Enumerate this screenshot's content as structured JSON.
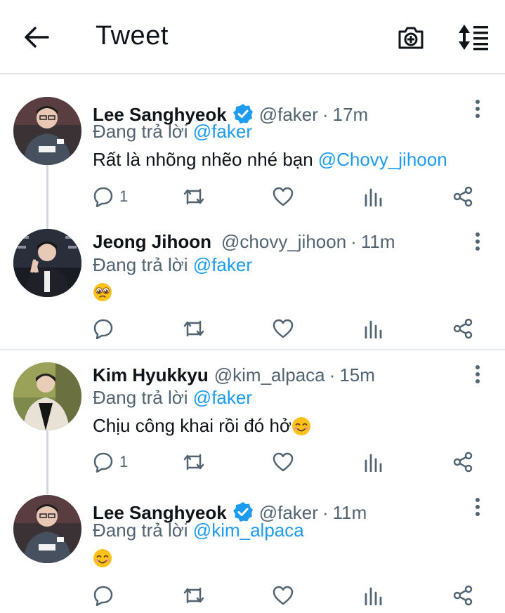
{
  "header": {
    "title": "Tweet",
    "back_icon": "arrow-left-icon",
    "camera_icon": "camera-plus-icon",
    "sort_icon": "sort-icon"
  },
  "colors": {
    "accent": "#1d9bf0",
    "secondary_text": "#536471",
    "primary_text": "#0f1419",
    "thread_line": "#cfd9de"
  },
  "tweets": [
    {
      "name": "Lee Sanghyeok",
      "verified": true,
      "handle": "@faker",
      "dot": "·",
      "time": "17m",
      "reply_prefix": "Đang trả lời",
      "reply_to": "@faker",
      "text": "Rất là nhõng nhẽo nhé bạn",
      "text_mention": "@Chovy_jihoon",
      "reply_count": "1"
    },
    {
      "name": "Jeong Jihoon",
      "verified": false,
      "handle": "@chovy_jihoon",
      "dot": "·",
      "time": "11m",
      "reply_prefix": "Đang trả lời",
      "reply_to": "@faker",
      "emoji": "pleading-face-emoji",
      "reply_count": ""
    },
    {
      "name": "Kim Hyukkyu",
      "verified": false,
      "handle": "@kim_alpaca",
      "dot": "·",
      "time": "15m",
      "reply_prefix": "Đang trả lời",
      "reply_to": "@faker",
      "text": "Chịu công khai rồi đó hở",
      "emoji": "smiling-face-emoji",
      "reply_count": "1"
    },
    {
      "name": "Lee Sanghyeok",
      "verified": true,
      "handle": "@faker",
      "dot": "·",
      "time": "11m",
      "reply_prefix": "Đang trả lời",
      "reply_to": "@kim_alpaca",
      "emoji": "smiling-face-emoji",
      "reply_count": ""
    }
  ]
}
